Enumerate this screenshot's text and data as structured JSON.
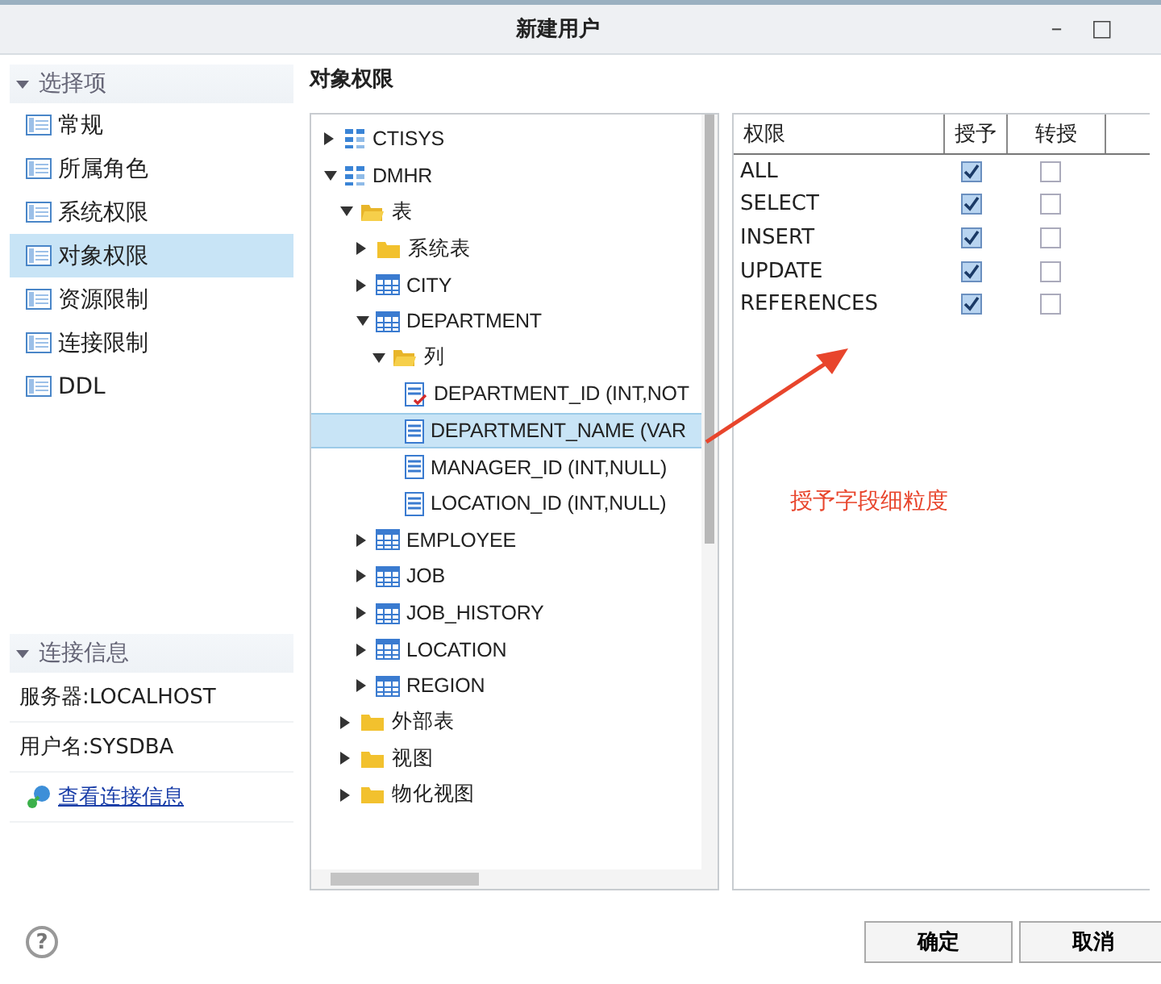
{
  "window": {
    "title": "新建用户",
    "controls": [
      "–",
      "□"
    ]
  },
  "sidebar": {
    "title": "选择项",
    "expanded": true,
    "items": [
      {
        "label": "常规",
        "selected": false
      },
      {
        "label": "所属角色",
        "selected": false
      },
      {
        "label": "系统权限",
        "selected": false
      },
      {
        "label": "对象权限",
        "selected": true
      },
      {
        "label": "资源限制",
        "selected": false
      },
      {
        "label": "连接限制",
        "selected": false
      },
      {
        "label": "DDL",
        "selected": false
      }
    ]
  },
  "connection": {
    "title": "连接信息",
    "expanded": true,
    "server": "服务器:LOCALHOST",
    "user": "用户名:SYSDBA",
    "link": "查看连接信息"
  },
  "panel_title": "对象权限",
  "tree": {
    "nodes": [
      {
        "kind": "schema",
        "label": "CTISYS",
        "expanded": false,
        "selected": false
      },
      {
        "kind": "schema",
        "label": "DMHR",
        "expanded": true,
        "selected": false,
        "children": [
          {
            "kind": "folder",
            "label": "表",
            "expanded": true,
            "selected": false,
            "children": [
              {
                "kind": "folder",
                "label": "系统表",
                "expanded": false,
                "selected": false
              },
              {
                "kind": "table",
                "label": "CITY",
                "expanded": false,
                "selected": false
              },
              {
                "kind": "table",
                "label": "DEPARTMENT",
                "expanded": true,
                "selected": false,
                "children": [
                  {
                    "kind": "folder",
                    "label": "列",
                    "expanded": true,
                    "selected": false,
                    "children": [
                      {
                        "kind": "key_column",
                        "label": "DEPARTMENT_ID (INT,NOT",
                        "selected": false
                      },
                      {
                        "kind": "column",
                        "label": "DEPARTMENT_NAME (VAR",
                        "selected": true
                      },
                      {
                        "kind": "column",
                        "label": "MANAGER_ID (INT,NULL)",
                        "selected": false
                      },
                      {
                        "kind": "column",
                        "label": "LOCATION_ID (INT,NULL)",
                        "selected": false
                      }
                    ]
                  }
                ]
              },
              {
                "kind": "table",
                "label": "EMPLOYEE",
                "expanded": false,
                "selected": false
              },
              {
                "kind": "table",
                "label": "JOB",
                "expanded": false,
                "selected": false
              },
              {
                "kind": "table",
                "label": "JOB_HISTORY",
                "expanded": false,
                "selected": false
              },
              {
                "kind": "table",
                "label": "LOCATION",
                "expanded": false,
                "selected": false
              },
              {
                "kind": "table",
                "label": "REGION",
                "expanded": false,
                "selected": false
              }
            ]
          },
          {
            "kind": "folder",
            "label": "外部表",
            "expanded": false,
            "selected": false
          },
          {
            "kind": "folder",
            "label": "视图",
            "expanded": false,
            "selected": false
          },
          {
            "kind": "folder",
            "label": "物化视图",
            "expanded": false,
            "selected": false
          }
        ]
      }
    ]
  },
  "permissions": {
    "columns": [
      "权限",
      "授予",
      "转授"
    ],
    "rows": [
      {
        "name": "ALL",
        "granted": true,
        "delegable": false
      },
      {
        "name": "SELECT",
        "granted": true,
        "delegable": false
      },
      {
        "name": "INSERT",
        "granted": true,
        "delegable": false
      },
      {
        "name": "UPDATE",
        "granted": true,
        "delegable": false
      },
      {
        "name": "REFERENCES",
        "granted": true,
        "delegable": false
      }
    ]
  },
  "annotation": "授予字段细粒度",
  "help": "?",
  "buttons": [
    "确定",
    "取消"
  ]
}
